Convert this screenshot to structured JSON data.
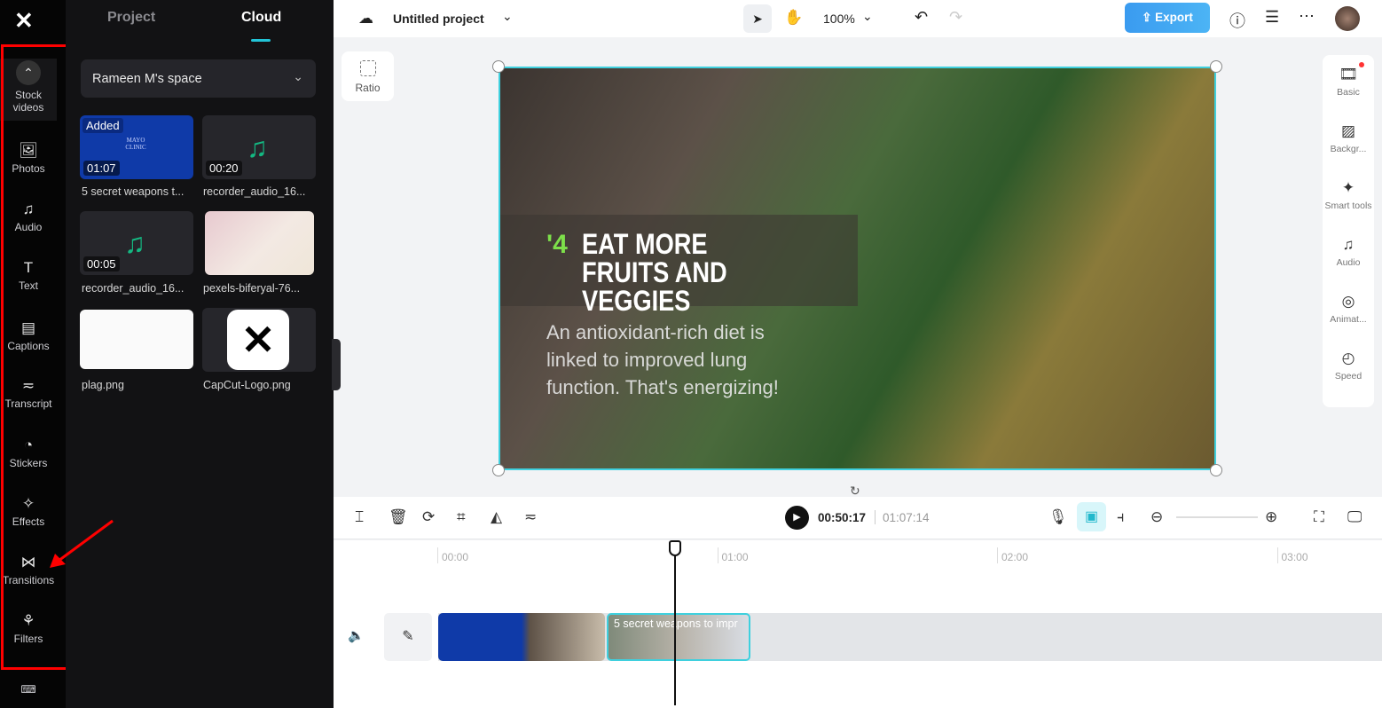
{
  "rail": {
    "items": [
      {
        "label": "Stock videos",
        "icon": "chevron-up-icon"
      },
      {
        "label": "Photos",
        "icon": "image-icon"
      },
      {
        "label": "Audio",
        "icon": "music-icon"
      },
      {
        "label": "Text",
        "icon": "text-icon"
      },
      {
        "label": "Captions",
        "icon": "captions-icon"
      },
      {
        "label": "Transcript",
        "icon": "transcript-icon"
      },
      {
        "label": "Stickers",
        "icon": "sticker-icon"
      },
      {
        "label": "Effects",
        "icon": "effects-icon"
      },
      {
        "label": "Transitions",
        "icon": "transitions-icon"
      },
      {
        "label": "Filters",
        "icon": "filters-icon"
      }
    ]
  },
  "panel": {
    "tabs": [
      "Project",
      "Cloud"
    ],
    "active_tab": "Cloud",
    "space": "Rameen M's space",
    "items": [
      {
        "name": "5 secret weapons t...",
        "duration": "01:07",
        "badge": "Added",
        "thumb": "MAYO CLINIC"
      },
      {
        "name": "recorder_audio_16...",
        "duration": "00:20"
      },
      {
        "name": "recorder_audio_16...",
        "duration": "00:05"
      },
      {
        "name": "pexels-biferyal-76..."
      },
      {
        "name": "plag.png"
      },
      {
        "name": "CapCut-Logo.png"
      }
    ]
  },
  "topbar": {
    "project_title": "Untitled project",
    "zoom": "100%",
    "export": "Export"
  },
  "canvas": {
    "ratio_label": "Ratio",
    "video_number": "'4",
    "video_headline": "EAT MORE FRUITS AND VEGGIES",
    "video_body": "An antioxidant-rich diet is linked to improved lung function. That's energizing!"
  },
  "right_panel": [
    {
      "label": "Basic",
      "icon": "film-icon"
    },
    {
      "label": "Backgr...",
      "icon": "background-icon"
    },
    {
      "label": "Smart tools",
      "icon": "magic-wand-icon"
    },
    {
      "label": "Audio",
      "icon": "music-icon"
    },
    {
      "label": "Animat...",
      "icon": "animation-icon"
    },
    {
      "label": "Speed",
      "icon": "speed-icon"
    }
  ],
  "player": {
    "current_time": "00:50:17",
    "total_time": "01:07:14"
  },
  "timeline": {
    "ticks": [
      "00:00",
      "01:00",
      "02:00",
      "03:00"
    ],
    "clip_title": "5 secret weapons to impr",
    "playhead_fraction": 0.77
  },
  "colors": {
    "accent": "#3fd0de",
    "export": "#3a9bf0",
    "annotation": "#ff0000"
  }
}
